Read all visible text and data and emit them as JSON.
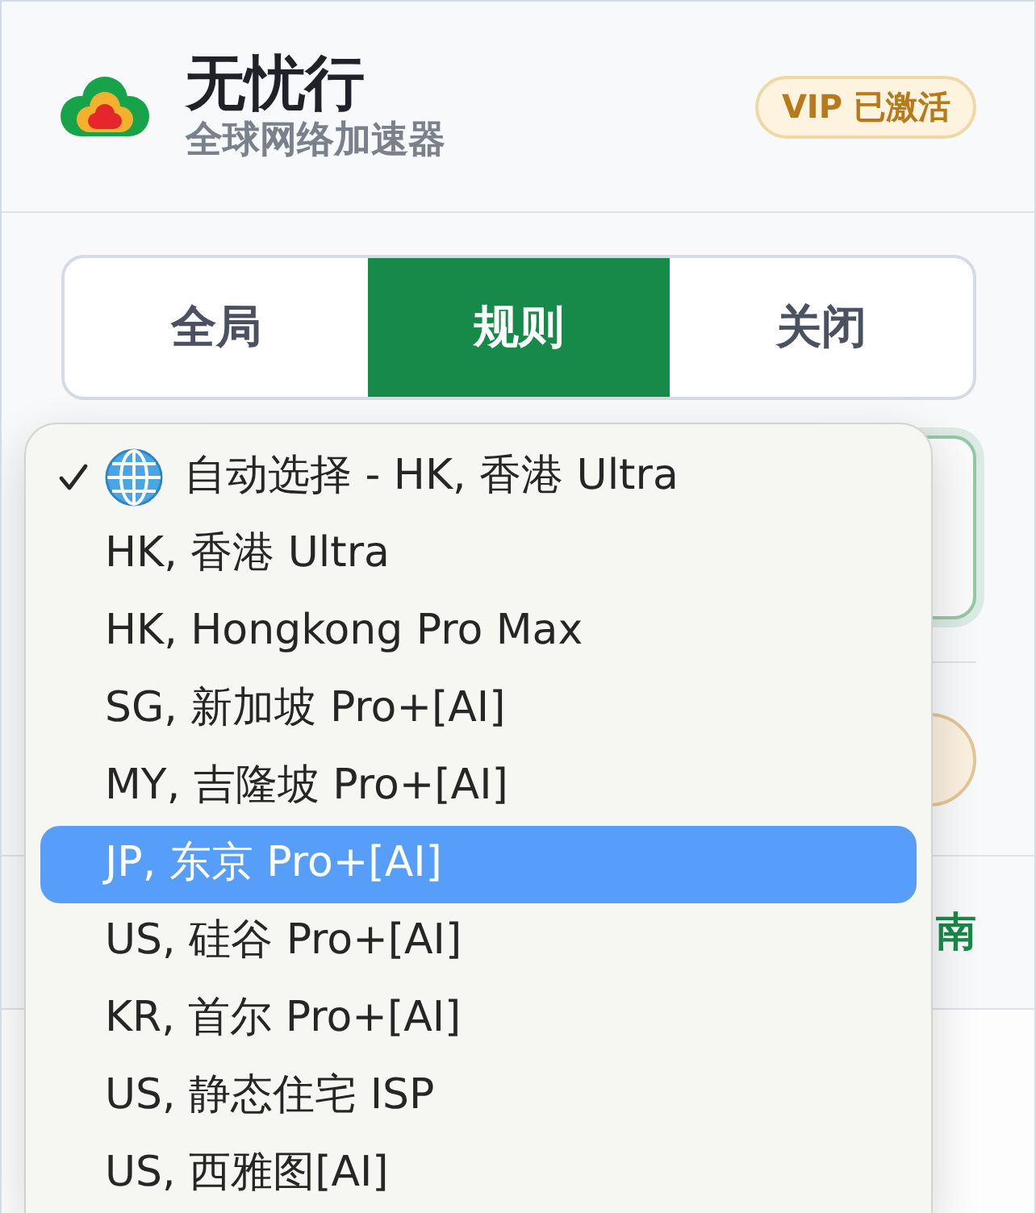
{
  "header": {
    "title": "无忧行",
    "subtitle": "全球网络加速器",
    "badge": "VIP 已激活"
  },
  "mode_tabs": [
    {
      "label": "全局",
      "selected": false
    },
    {
      "label": "规则",
      "selected": true
    },
    {
      "label": "关闭",
      "selected": false
    }
  ],
  "node_menu": {
    "options": [
      {
        "kind": "auto",
        "label": "自动选择 - HK, 香港 Ultra",
        "selected": true,
        "highlighted": false
      },
      {
        "kind": "server",
        "label": "HK, 香港 Ultra",
        "selected": false,
        "highlighted": false
      },
      {
        "kind": "server",
        "label": "HK, Hongkong Pro Max",
        "selected": false,
        "highlighted": false
      },
      {
        "kind": "server",
        "label": "SG, 新加坡 Pro+[AI]",
        "selected": false,
        "highlighted": false
      },
      {
        "kind": "server",
        "label": "MY, 吉隆坡 Pro+[AI]",
        "selected": false,
        "highlighted": false
      },
      {
        "kind": "server",
        "label": "JP, 东京 Pro+[AI]",
        "selected": false,
        "highlighted": true
      },
      {
        "kind": "server",
        "label": "US, 硅谷 Pro+[AI]",
        "selected": false,
        "highlighted": false
      },
      {
        "kind": "server",
        "label": "KR, 首尔 Pro+[AI]",
        "selected": false,
        "highlighted": false
      },
      {
        "kind": "server",
        "label": "US, 静态住宅 ISP",
        "selected": false,
        "highlighted": false
      },
      {
        "kind": "server",
        "label": "US, 西雅图[AI]",
        "selected": false,
        "highlighted": false
      }
    ]
  },
  "footer": {
    "link": "南"
  }
}
